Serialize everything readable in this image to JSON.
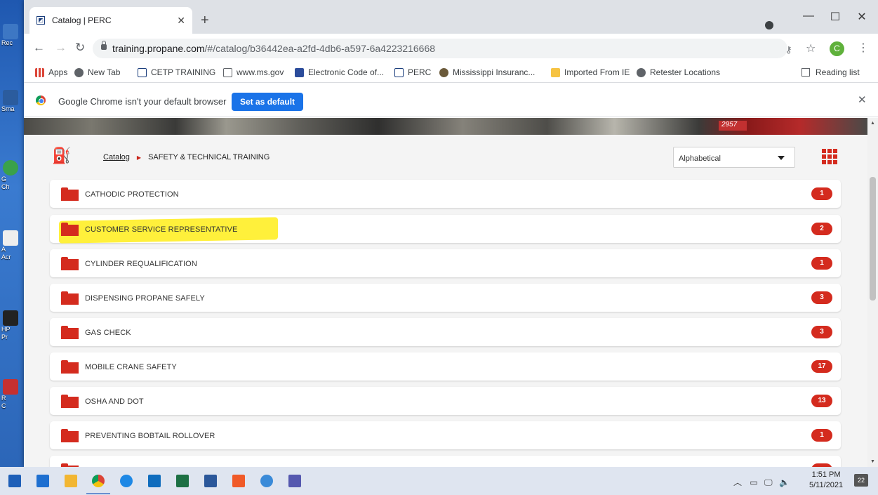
{
  "desktop": {
    "icons": [
      {
        "label": "Rec"
      },
      {
        "label": "Sma"
      },
      {
        "label": "G\nCh"
      },
      {
        "label": "A\nAcr"
      },
      {
        "label": "HP\nPr"
      },
      {
        "label": "R\nC"
      }
    ]
  },
  "browser": {
    "tab_title": "Catalog | PERC",
    "tab_favicon": "PERC",
    "url_host": "training.propane.com",
    "url_path": "/#/catalog/b36442ea-a2fd-4db6-a597-6a4223216668",
    "avatar_letter": "C",
    "bookmarks": [
      {
        "label": "Apps",
        "icon": "apps-icon",
        "color": "#1a73e8"
      },
      {
        "label": "New Tab",
        "icon": "globe-icon",
        "color": "#5f6368"
      },
      {
        "label": "CETP TRAINING",
        "icon": "perc-icon",
        "color": "#1a3d7c"
      },
      {
        "label": "www.ms.gov",
        "icon": "doc-icon",
        "color": "#5f6368"
      },
      {
        "label": "Electronic Code of...",
        "icon": "gpo-icon",
        "color": "#2b4c9b"
      },
      {
        "label": "PERC",
        "icon": "perc-icon",
        "color": "#1a3d7c"
      },
      {
        "label": "Mississippi Insuranc...",
        "icon": "seal-icon",
        "color": "#6b5a3a"
      },
      {
        "label": "Imported From IE",
        "icon": "folder-icon",
        "color": "#f6c343"
      },
      {
        "label": "Retester Locations",
        "icon": "globe-icon",
        "color": "#5f6368"
      }
    ],
    "reading_list": "Reading list",
    "infobar": {
      "message": "Google Chrome isn't your default browser",
      "button": "Set as default"
    }
  },
  "page": {
    "breadcrumb": {
      "root": "Catalog",
      "current": "SAFETY & TECHNICAL TRAINING"
    },
    "sort": {
      "selected": "Alphabetical"
    },
    "hero_plate": "2957",
    "items": [
      {
        "name": "CATHODIC PROTECTION",
        "count": "1"
      },
      {
        "name": "CUSTOMER SERVICE REPRESENTATIVE",
        "count": "2",
        "highlighted": true
      },
      {
        "name": "CYLINDER REQUALIFICATION",
        "count": "1"
      },
      {
        "name": "DISPENSING PROPANE SAFELY",
        "count": "3"
      },
      {
        "name": "GAS CHECK",
        "count": "3"
      },
      {
        "name": "MOBILE CRANE SAFETY",
        "count": "17"
      },
      {
        "name": "OSHA AND DOT",
        "count": "13"
      },
      {
        "name": "PREVENTING BOBTAIL ROLLOVER",
        "count": "1"
      },
      {
        "name": "",
        "count": ""
      }
    ],
    "accent_color": "#d42b1e",
    "highlight_color": "#ffef2a"
  },
  "taskbar": {
    "apps": [
      {
        "name": "windows-start-icon",
        "color": "#1e5fb8"
      },
      {
        "name": "media-player-icon",
        "color": "#1e6fd0"
      },
      {
        "name": "file-explorer-icon",
        "color": "#f2b632"
      },
      {
        "name": "chrome-icon",
        "color": "#db4437"
      },
      {
        "name": "internet-explorer-icon",
        "color": "#1e88e5"
      },
      {
        "name": "outlook-icon",
        "color": "#0f6cbd"
      },
      {
        "name": "excel-icon",
        "color": "#1d7044"
      },
      {
        "name": "word-icon",
        "color": "#2b579a"
      },
      {
        "name": "b-app-icon",
        "color": "#f05a28"
      },
      {
        "name": "network-app-icon",
        "color": "#3a8ad8"
      },
      {
        "name": "teams-icon",
        "color": "#5558af"
      }
    ],
    "time": "1:51 PM",
    "date": "5/11/2021",
    "notifications": "22"
  }
}
